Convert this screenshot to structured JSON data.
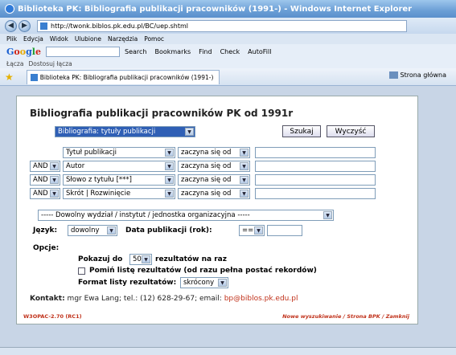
{
  "window": {
    "title": "Biblioteka PK: Bibliografia publikacji pracowników (1991-) - Windows Internet Explorer"
  },
  "address": {
    "url": "http://twonk.biblos.pk.edu.pl/BC/uep.shtml"
  },
  "menu": [
    "Plik",
    "Edycja",
    "Widok",
    "Ulubione",
    "Narzędzia",
    "Pomoc"
  ],
  "google": {
    "logo_G": "G",
    "logo_o1": "o",
    "logo_o2": "o",
    "logo_g": "g",
    "logo_l": "l",
    "logo_e": "e",
    "search_label": "Search",
    "bookmarks": "Bookmarks",
    "find": "Find",
    "check": "Check",
    "autofill": "AutoFill"
  },
  "links": {
    "label": "Łącza",
    "item": "Dostosuj łącza"
  },
  "tab": {
    "title": "Biblioteka PK: Bibliografia publikacji pracowników (1991-)",
    "home": "Strona główna"
  },
  "form": {
    "title": "Bibliografia publikacji pracowników PK od 1991r",
    "bib_select": "Bibliografia: tytuły publikacji",
    "search_btn": "Szukaj",
    "clear_btn": "Wyczyść",
    "rows": [
      {
        "op": "",
        "field": "Tytuł publikacji",
        "cond": "zaczyna się od"
      },
      {
        "op": "AND",
        "field": "Autor",
        "cond": "zaczyna się od"
      },
      {
        "op": "AND",
        "field": "Słowo z tytułu [***]",
        "cond": "zaczyna się od"
      },
      {
        "op": "AND",
        "field": "Skrót | Rozwinięcie",
        "cond": "zaczyna się od"
      }
    ],
    "dept": "----- Dowolny wydział / instytut / jednostka organizacyjna -----",
    "lang_label": "Język:",
    "lang_value": "dowolny",
    "date_label": "Data publikacji (rok):",
    "date_op": "==",
    "options_label": "Opcje:",
    "show_pre": "Pokazuj do",
    "show_value": "50",
    "show_post": "rezultatów na raz",
    "skip_label": "Pomiń listę rezultatów (od razu pełna postać rekordów)",
    "format_label": "Format listy rezultatów:",
    "format_value": "skrócony"
  },
  "contact": {
    "label": "Kontakt:",
    "text": "mgr Ewa Lang; tel.: (12) 628-29-67; email:",
    "email": "bp@biblos.pk.edu.pl"
  },
  "footer": {
    "left": "W3OPAC-2.70 (RC1)",
    "right": "Nowe wyszukiwanie / Strona BPK / Zamknij"
  }
}
